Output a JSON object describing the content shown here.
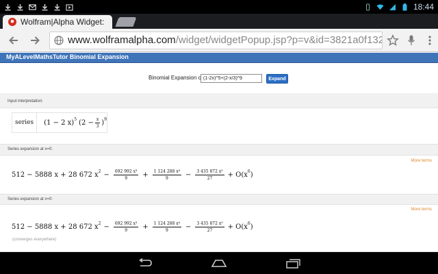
{
  "status_bar": {
    "notification_icons": [
      "download-icon",
      "download-icon",
      "mail-icon",
      "download-icon",
      "download-icon",
      "play-store-icon"
    ],
    "right_icons": [
      "vibrate-icon",
      "wifi-icon",
      "cell-signal-icon",
      "battery-icon"
    ],
    "time": "18:44"
  },
  "browser": {
    "active_tab_title": "Wolfram|Alpha Widget:",
    "url_domain": "www.wolframalpha.com",
    "url_path": "/widget/widgetPopup.jsp?p=v&id=3821a0f132a064c8464a",
    "colors": {
      "favicon": "#d42b1e"
    }
  },
  "widget": {
    "title": "MyALevelMathsTutor Binomial Expansion",
    "header_color": "#3f74b9",
    "form": {
      "label": "Binomial Expansion of",
      "input_value": "(1-2x)^5+(2-x/3)^9",
      "button_label": "Expand"
    }
  },
  "pods": {
    "input": {
      "title": "Input interpretation:",
      "label": "series",
      "expr_left": "(1 − 2 x)",
      "expr_exp5": "5",
      "expr_mid": "(2 −",
      "frac_num": "x",
      "frac_den": "3",
      "expr_right": ")",
      "expr_exp9": "9"
    },
    "series1": {
      "title": "Series expansion at x=0:",
      "more": "More terms",
      "t1": "512 − 5888 x + 28 672 x",
      "t1_exp": "2",
      "minus": "−",
      "plus": "+",
      "f1_num": "692 992 x³",
      "f1_den": "9",
      "f2_num": "1 124 288 x⁴",
      "f2_den": "9",
      "f3_num": "3 435 872 x⁵",
      "f3_den": "27",
      "tail": "+ O(x",
      "tail_exp": "6",
      "tail_close": ")"
    },
    "series2": {
      "title": "Series expansion at x=0:",
      "more": "More terms",
      "note": "(converges everywhere)"
    }
  },
  "nav_bar": {
    "buttons": [
      "back-icon",
      "home-icon",
      "recent-apps-icon"
    ]
  }
}
